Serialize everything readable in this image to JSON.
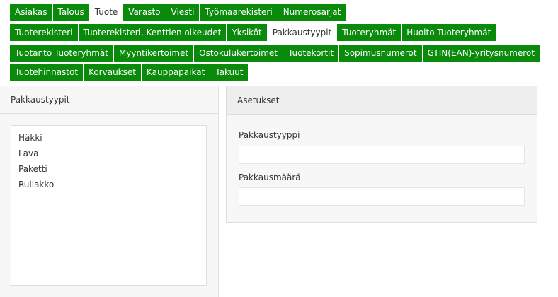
{
  "nav": {
    "rows": [
      [
        {
          "label": "Asiakas",
          "active": false
        },
        {
          "label": "Talous",
          "active": false
        },
        {
          "label": "Tuote",
          "active": true
        },
        {
          "label": "Varasto",
          "active": false
        },
        {
          "label": "Viesti",
          "active": false
        },
        {
          "label": "Työmaarekisteri",
          "active": false
        },
        {
          "label": "Numerosarjat",
          "active": false
        }
      ],
      [
        {
          "label": "Tuoterekisteri",
          "active": false
        },
        {
          "label": "Tuoterekisteri, Kenttien oikeudet",
          "active": false
        },
        {
          "label": "Yksiköt",
          "active": false
        },
        {
          "label": "Pakkaustyypit",
          "active": true
        },
        {
          "label": "Tuoteryhmät",
          "active": false
        },
        {
          "label": "Huolto Tuoteryhmät",
          "active": false
        }
      ],
      [
        {
          "label": "Tuotanto Tuoteryhmät",
          "active": false
        },
        {
          "label": "Myyntikertoimet",
          "active": false
        },
        {
          "label": "Ostokulukertoimet",
          "active": false
        },
        {
          "label": "Tuotekortit",
          "active": false
        },
        {
          "label": "Sopimusnumerot",
          "active": false
        },
        {
          "label": "GTIN(EAN)-yritysnumerot",
          "active": false
        }
      ],
      [
        {
          "label": "Tuotehinnastot",
          "active": false
        },
        {
          "label": "Korvaukset",
          "active": false
        },
        {
          "label": "Kauppapaikat",
          "active": false
        },
        {
          "label": "Takuut",
          "active": false
        }
      ]
    ]
  },
  "left_panel": {
    "title": "Pakkaustyypit",
    "items": [
      "Häkki",
      "Lava",
      "Paketti",
      "Rullakko"
    ]
  },
  "right_panel": {
    "title": "Asetukset",
    "fields": {
      "type_label": "Pakkaustyyppi",
      "type_value": "",
      "qty_label": "Pakkausmäärä",
      "qty_value": ""
    }
  },
  "colors": {
    "nav_bg": "#0a8a0a",
    "nav_text": "#ffffff",
    "active_bg": "#ffffff"
  }
}
